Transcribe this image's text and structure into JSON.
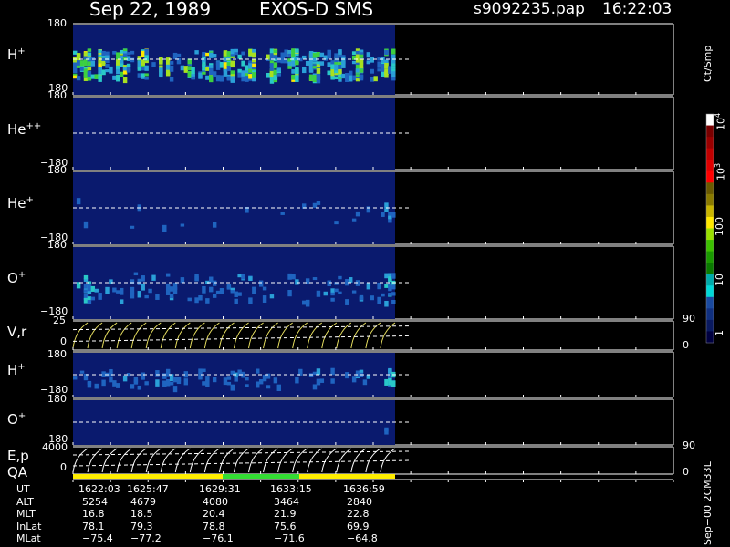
{
  "header": {
    "date": "Sep 22, 1989",
    "instrument": "EXOS-D SMS",
    "file": "s9092235.pap",
    "time": "16:22:03"
  },
  "panels": [
    {
      "label_base": "H",
      "label_sup": "+",
      "tick_top": "180",
      "tick_bottom": "−180"
    },
    {
      "label_base": "He",
      "label_sup": "++",
      "tick_top": "180",
      "tick_bottom": "−180"
    },
    {
      "label_base": "He",
      "label_sup": "+",
      "tick_top": "180",
      "tick_bottom": "−180"
    },
    {
      "label_base": "O",
      "label_sup": "+",
      "tick_top": "180",
      "tick_bottom": "−180"
    },
    {
      "label_base": "V,r",
      "label_sup": "",
      "tick_top": "25",
      "tick_bottom": "0",
      "right_top": "90",
      "right_bottom": "0"
    },
    {
      "label_base": "H",
      "label_sup": "+",
      "tick_top": "180",
      "tick_bottom": "−180"
    },
    {
      "label_base": "O",
      "label_sup": "+",
      "tick_top": "180",
      "tick_bottom": "−180"
    },
    {
      "label_base": "E,p",
      "label_sup": "",
      "tick_top": "4000",
      "tick_bottom": "0",
      "right_top": "90",
      "right_bottom": "0"
    }
  ],
  "qa_label": "QA",
  "colorbar": {
    "unit": "Ct/Smp",
    "ticks": [
      {
        "base": "10",
        "exp": "4"
      },
      {
        "base": "10",
        "exp": "3"
      },
      {
        "base": "100",
        "exp": ""
      },
      {
        "base": "10",
        "exp": ""
      },
      {
        "base": "1",
        "exp": ""
      }
    ],
    "colors": [
      "#ffffff",
      "#7a0000",
      "#9a0000",
      "#c00000",
      "#e00000",
      "#ff0000",
      "#6a5a00",
      "#8a7a00",
      "#c8b400",
      "#ffe800",
      "#9ae000",
      "#3cc000",
      "#1a9a00",
      "#0a7a00",
      "#00aaaa",
      "#00d8d8",
      "#1a4aa0",
      "#103080",
      "#0a1a60",
      "#000040"
    ]
  },
  "footer": {
    "rows": [
      {
        "name": "UT",
        "values": [
          "1622:03",
          "1625:47",
          "1629:31",
          "1633:15",
          "1636:59"
        ]
      },
      {
        "name": "ALT",
        "values": [
          "5254",
          "4679",
          "4080",
          "3464",
          "2840"
        ]
      },
      {
        "name": "MLT",
        "values": [
          "16.8",
          "18.5",
          "20.4",
          "21.9",
          "22.8"
        ]
      },
      {
        "name": "InLat",
        "values": [
          "78.1",
          "79.3",
          "78.8",
          "75.6",
          "69.9"
        ]
      },
      {
        "name": "MLat",
        "values": [
          "−75.4",
          "−77.2",
          "−76.1",
          "−71.6",
          "−64.8"
        ]
      }
    ],
    "side_note": "Sep−00  2CM33L"
  },
  "chart_data": {
    "type": "heatmap",
    "title": "Sep 22, 1989   EXOS-D SMS",
    "ut_start": "1622:03",
    "ut_end": "1636:59",
    "x_ticks": [
      "1622:03",
      "1625:47",
      "1629:31",
      "1633:15",
      "1636:59"
    ],
    "panels": [
      {
        "name": "H+",
        "ylim": [
          -180,
          180
        ]
      },
      {
        "name": "He++",
        "ylim": [
          -180,
          180
        ]
      },
      {
        "name": "He+",
        "ylim": [
          -180,
          180
        ]
      },
      {
        "name": "O+",
        "ylim": [
          -180,
          180
        ]
      },
      {
        "name": "V,r",
        "ylim": [
          0,
          25
        ],
        "ylim_right": [
          0,
          90
        ]
      },
      {
        "name": "H+",
        "ylim": [
          -180,
          180
        ]
      },
      {
        "name": "O+",
        "ylim": [
          -180,
          180
        ]
      },
      {
        "name": "E,p",
        "ylim": [
          0,
          4000
        ],
        "ylim_right": [
          0,
          90
        ]
      }
    ],
    "color_scale": {
      "unit": "Ct/Smp",
      "ticks": [
        "1",
        "10",
        "100",
        "10^3",
        "10^4"
      ],
      "log": true
    },
    "qa": [
      {
        "from": "1622:03",
        "to": "1629:31",
        "color": "#ffee00"
      },
      {
        "from": "1629:31",
        "to": "1633:15",
        "color": "#33dd33"
      },
      {
        "from": "1633:15",
        "to": "1636:59",
        "color": "#ffee00"
      }
    ]
  }
}
